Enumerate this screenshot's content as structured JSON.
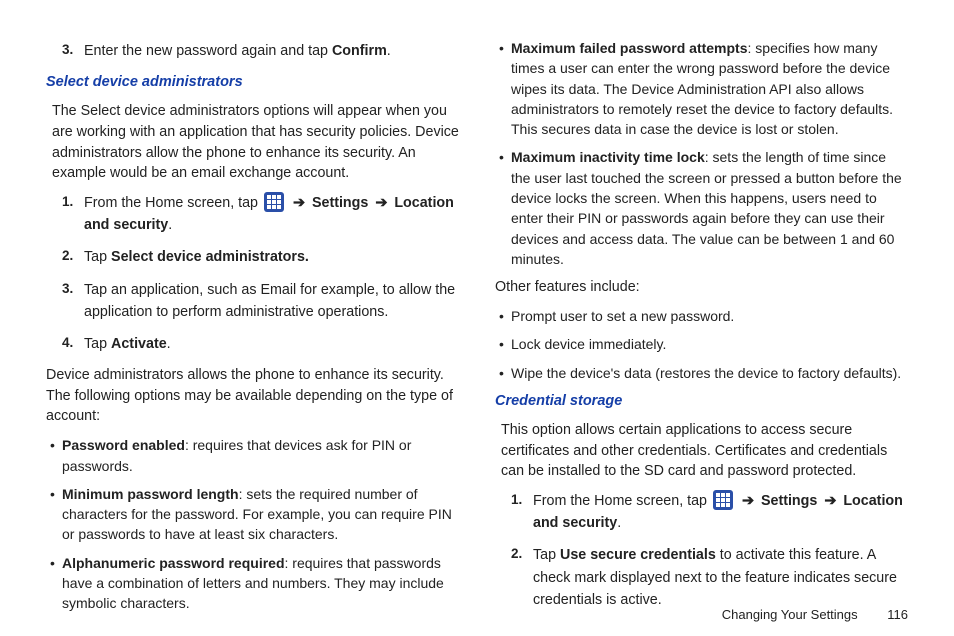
{
  "left": {
    "step3_pre": "Enter the new password again and tap ",
    "step3_bold": "Confirm",
    "step3_post": ".",
    "heading1": "Select device administrators",
    "para1": "The Select device administrators options will appear when you are working with an application that has security policies. Device administrators allow the phone to enhance its security. An example would be an email exchange account.",
    "admin_step1_pre": "From the Home screen, tap ",
    "settings_label": "Settings",
    "location_security_label": "Location and security",
    "admin_step2_pre": "Tap ",
    "admin_step2_bold": "Select device administrators.",
    "admin_step3": "Tap an application, such as Email for example, to allow the application to perform administrative operations.",
    "admin_step4_pre": "Tap ",
    "admin_step4_bold": "Activate",
    "admin_step4_post": ".",
    "para2": "Device administrators allows the phone to enhance its security. The following options may be available depending on the type of account:",
    "bullets": [
      {
        "bold": "Password enabled",
        "rest": ": requires that devices ask for PIN or passwords."
      },
      {
        "bold": "Minimum password length",
        "rest": ": sets the required number of characters for the password. For example, you can require PIN or passwords to have at least six characters."
      },
      {
        "bold": "Alphanumeric password required",
        "rest": ": requires that passwords have a combination of letters and numbers. They may include symbolic characters."
      }
    ]
  },
  "right": {
    "top_bullets": [
      {
        "bold": "Maximum failed password attempts",
        "rest": ": specifies how many times a user can enter the wrong password before the device wipes its data. The Device Administration API also allows administrators to remotely reset the device to factory defaults. This secures data in case the device is lost or stolen."
      },
      {
        "bold": "Maximum inactivity time lock",
        "rest": ": sets the length of time since the user last touched the screen or pressed a button before the device locks the screen. When this happens, users need to enter their PIN or passwords again before they can use their devices and access data. The value can be between 1 and 60 minutes."
      }
    ],
    "other_intro": "Other features include:",
    "other_bullets": [
      "Prompt user to set a new password.",
      "Lock device immediately.",
      "Wipe the device's data (restores the device to factory defaults)."
    ],
    "heading2": "Credential storage",
    "cred_para": "This option allows certain applications to access secure certificates and other credentials. Certificates and credentials can be installed to the SD card and password protected.",
    "cred_step1_pre": "From the Home screen, tap ",
    "cred_step2_pre": "Tap ",
    "cred_step2_bold": "Use secure credentials",
    "cred_step2_post": " to activate this feature. A check mark displayed next to the feature indicates secure credentials is active."
  },
  "markers": {
    "m1": "1.",
    "m2": "2.",
    "m3": "3.",
    "m4": "4."
  },
  "arrow": "➔",
  "footer": {
    "title": "Changing Your Settings",
    "page": "116"
  }
}
